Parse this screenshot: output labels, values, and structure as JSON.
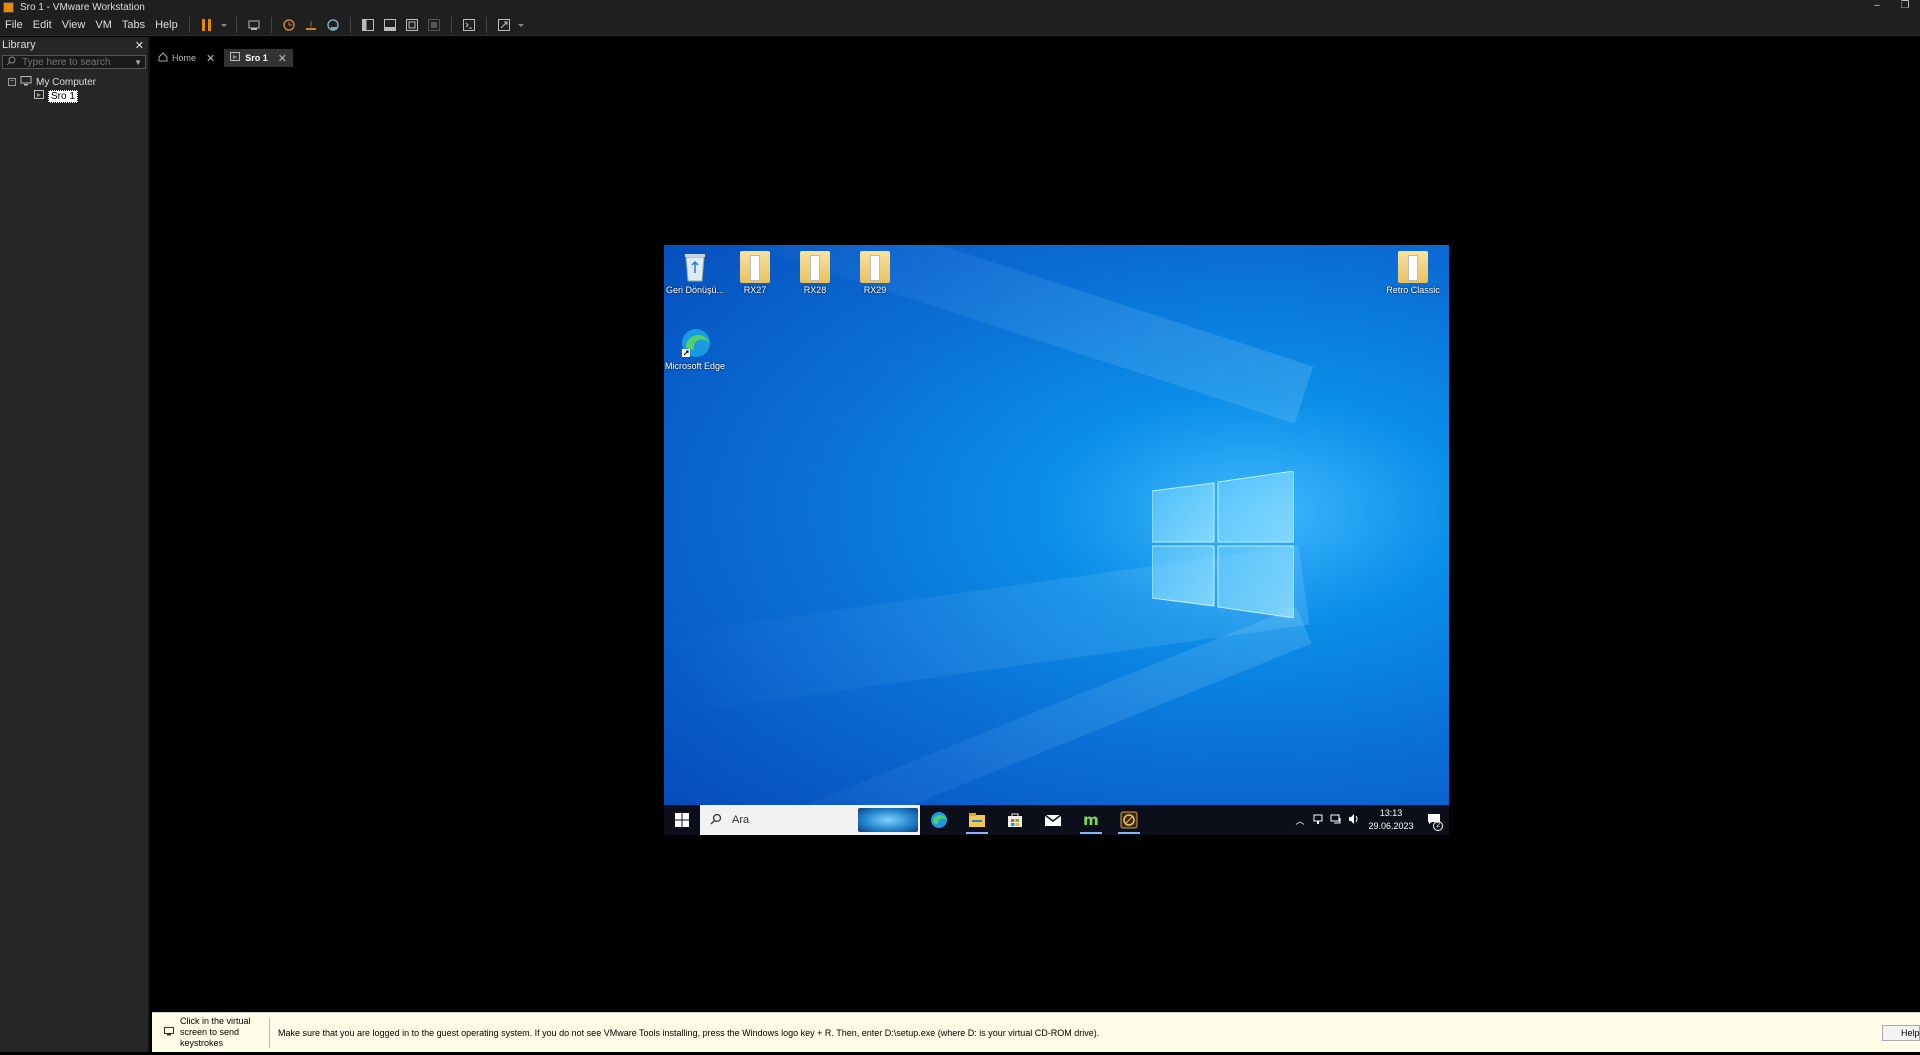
{
  "window": {
    "title": "Sro 1 - VMware Workstation"
  },
  "menu": [
    "File",
    "Edit",
    "View",
    "VM",
    "Tabs",
    "Help"
  ],
  "library": {
    "title": "Library",
    "search_placeholder": "Type here to search",
    "tree": {
      "root": "My Computer",
      "vm": "Sro 1"
    }
  },
  "tabs": [
    {
      "label": "Home",
      "active": false
    },
    {
      "label": "Sro 1",
      "active": true
    }
  ],
  "guest": {
    "desktop_icons": [
      {
        "label": "Geri Dönüşü...",
        "icon": "recycle-bin-icon"
      },
      {
        "label": "RX27",
        "icon": "folder-icon"
      },
      {
        "label": "RX28",
        "icon": "folder-icon"
      },
      {
        "label": "RX29",
        "icon": "folder-icon"
      },
      {
        "label": "Retro Classic",
        "icon": "folder-icon"
      },
      {
        "label": "Microsoft Edge",
        "icon": "edge-icon"
      }
    ],
    "taskbar": {
      "search_text": "Ara",
      "apps": [
        "edge-icon",
        "file-explorer-icon",
        "store-icon",
        "mail-icon",
        "m-app-icon",
        "game-launcher-icon"
      ],
      "time": "13:13",
      "date": "29.06.2023",
      "notification_count": "2"
    }
  },
  "hint": {
    "click_text": "Click in the virtual screen to send keystrokes",
    "message": "Make sure that you are logged in to the guest operating system. If you do not see VMware Tools installing, press the Windows logo key + R. Then, enter D:\\setup.exe (where D: is your virtual CD-ROM drive).",
    "help_label": "Help"
  },
  "colors": {
    "accent": "#e68a00",
    "desktop_blue": "#0a6fd6",
    "hint_bg": "#fffde7"
  }
}
